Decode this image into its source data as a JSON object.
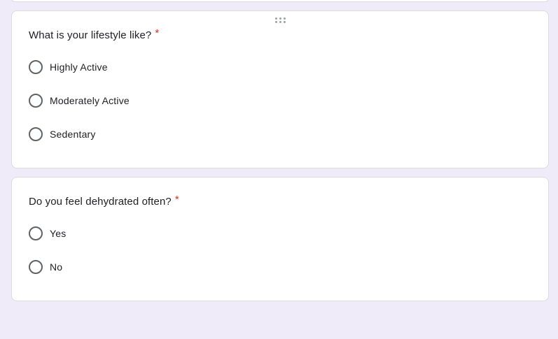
{
  "colors": {
    "background": "#f0ebf8",
    "card": "#ffffff",
    "card_border": "#dadce0",
    "required": "#d93025",
    "radio_border": "#5f6368",
    "text": "#202124"
  },
  "icons": {
    "drag_handle": "drag-handle-icon",
    "radio": "radio-unchecked-icon"
  },
  "questions": [
    {
      "title": "What is your lifestyle like?",
      "required_mark": "*",
      "options": [
        "Highly Active",
        "Moderately Active",
        "Sedentary"
      ]
    },
    {
      "title": "Do you feel dehydrated often?",
      "required_mark": "*",
      "options": [
        "Yes",
        "No"
      ]
    }
  ]
}
